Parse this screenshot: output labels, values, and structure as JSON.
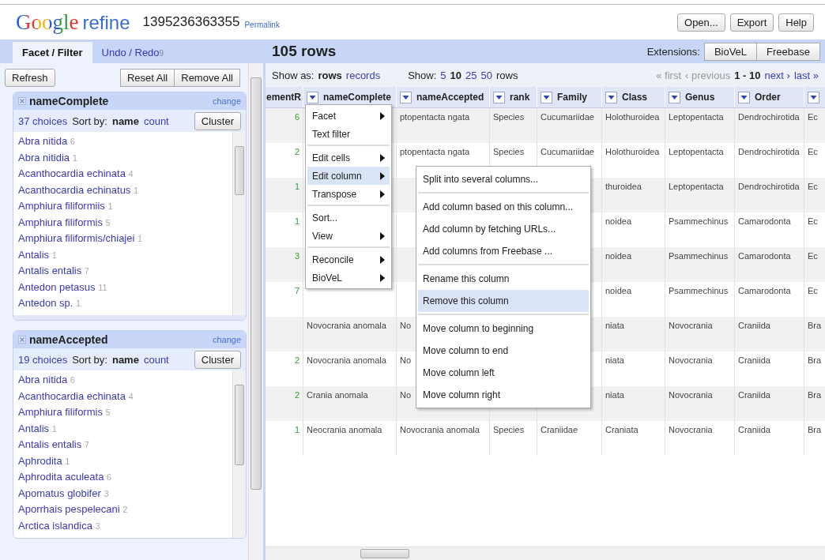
{
  "header": {
    "logo_word": "Google",
    "logo_suffix": "refine",
    "project_name": "1395236363355",
    "permalink": "Permalink",
    "buttons": [
      "Open...",
      "Export",
      "Help"
    ]
  },
  "left_tabs": [
    {
      "label": "Facet / Filter",
      "selected": true
    },
    {
      "label": "Undo / Redo",
      "count": "9",
      "selected": false
    }
  ],
  "facet_buttons": {
    "refresh": "Refresh",
    "others": [
      "Reset All",
      "Remove All"
    ]
  },
  "facets": [
    {
      "title": "nameComplete",
      "change": "change",
      "choices": "37 choices",
      "sort_label": "Sort by:",
      "sort_options": [
        {
          "label": "name",
          "selected": true
        },
        {
          "label": "count",
          "selected": false
        }
      ],
      "cluster": "Cluster",
      "items": [
        {
          "name": "Abra nitida",
          "count": "6"
        },
        {
          "name": "Abra nitidia",
          "count": "1"
        },
        {
          "name": "Acanthocardia echinata",
          "count": "4"
        },
        {
          "name": "Acanthocardia echinatus",
          "count": "1"
        },
        {
          "name": "Amphiura filiformiis",
          "count": "1"
        },
        {
          "name": "Amphiura filiformis",
          "count": "5"
        },
        {
          "name": "Amphiura filiformis/chiajei",
          "count": "1"
        },
        {
          "name": "Antalis",
          "count": "1"
        },
        {
          "name": "Antalis entalis",
          "count": "7"
        },
        {
          "name": "Antedon petasus",
          "count": "11"
        },
        {
          "name": "Antedon sp.",
          "count": "1"
        }
      ]
    },
    {
      "title": "nameAccepted",
      "change": "change",
      "choices": "19 choices",
      "sort_label": "Sort by:",
      "sort_options": [
        {
          "label": "name",
          "selected": true
        },
        {
          "label": "count",
          "selected": false
        }
      ],
      "cluster": "Cluster",
      "items": [
        {
          "name": "Abra nitida",
          "count": "6"
        },
        {
          "name": "Acanthocardia echinata",
          "count": "4"
        },
        {
          "name": "Amphiura filiformis",
          "count": "5"
        },
        {
          "name": "Antalis",
          "count": "1"
        },
        {
          "name": "Antalis entalis",
          "count": "7"
        },
        {
          "name": "Aphrodita",
          "count": "1"
        },
        {
          "name": "Aphrodita aculeata",
          "count": "6"
        },
        {
          "name": "Apomatus globifer",
          "count": "3"
        },
        {
          "name": "Aporrhais pespelecani",
          "count": "2"
        },
        {
          "name": "Arctica islandica",
          "count": "3"
        }
      ]
    }
  ],
  "grid": {
    "row_count": "105 rows",
    "extensions_label": "Extensions:",
    "extensions": [
      "BioVeL",
      "Freebase"
    ],
    "show_as_label": "Show as:",
    "show_as": [
      {
        "label": "rows",
        "selected": true
      },
      {
        "label": "records",
        "selected": false
      }
    ],
    "show_label": "Show:",
    "page_sizes": [
      {
        "label": "5",
        "selected": false
      },
      {
        "label": "10",
        "selected": true
      },
      {
        "label": "25",
        "selected": false
      },
      {
        "label": "50",
        "selected": false
      }
    ],
    "page_sizes_suffix": "rows",
    "pager": [
      {
        "kind": "link",
        "label": "« first",
        "disabled": true
      },
      {
        "kind": "link",
        "label": "‹ previous",
        "disabled": true
      },
      {
        "kind": "range",
        "label": "1 - 10"
      },
      {
        "kind": "link",
        "label": "next ›",
        "disabled": false
      },
      {
        "kind": "link",
        "label": "last »",
        "disabled": false
      }
    ]
  },
  "table": {
    "columns": [
      {
        "label": "ementR",
        "menu_button": false
      },
      {
        "label": "nameComplete",
        "menu_button": true
      },
      {
        "label": "nameAccepted",
        "menu_button": true
      },
      {
        "label": "rank",
        "menu_button": true
      },
      {
        "label": "Family",
        "menu_button": true
      },
      {
        "label": "Class",
        "menu_button": true
      },
      {
        "label": "Genus",
        "menu_button": true
      },
      {
        "label": "Order",
        "menu_button": true
      },
      {
        "menu_button": true
      }
    ],
    "rows": [
      {
        "cells": [
          "6",
          null,
          "ptopentacta ngata",
          "Species",
          "Cucumariidae",
          "Holothuroidea",
          "Leptopentacta",
          "Dendrochirotida",
          "Ec"
        ]
      },
      {
        "cells": [
          "2",
          null,
          "ptopentacta ngata",
          "Species",
          "Cucumariidae",
          "Holothuroidea",
          "Leptopentacta",
          "Dendrochirotida",
          "Ec"
        ]
      },
      {
        "cells": [
          "1",
          null,
          null,
          null,
          null,
          "thuroidea",
          "Leptopentacta",
          "Dendrochirotida",
          "Ec"
        ]
      },
      {
        "cells": [
          "1",
          null,
          null,
          null,
          null,
          "noidea",
          "Psammechinus",
          "Camarodonta",
          "Ec"
        ]
      },
      {
        "cells": [
          "3",
          null,
          null,
          null,
          null,
          "noidea",
          "Psammechinus",
          "Camarodonta",
          "Ec"
        ]
      },
      {
        "cells": [
          "7",
          null,
          null,
          null,
          null,
          "noidea",
          "Psammechinus",
          "Camarodonta",
          "Ec"
        ]
      },
      {
        "cells": [
          null,
          "Novocrania anomala",
          "No",
          null,
          null,
          "niata",
          "Novocrania",
          "Craniida",
          "Bra"
        ]
      },
      {
        "cells": [
          "2",
          "Novocrania anomala",
          "No",
          null,
          null,
          "niata",
          "Novocrania",
          "Craniida",
          "Bra"
        ]
      },
      {
        "cells": [
          "2",
          "Crania anomala",
          "No",
          null,
          null,
          "niata",
          "Novocrania",
          "Craniida",
          "Bra"
        ]
      },
      {
        "cells": [
          "1",
          "Neocrania anomala",
          "Novocrania anomala",
          "Species",
          "Craniidae",
          "Craniata",
          "Novocrania",
          "Craniida",
          "Bra"
        ]
      }
    ]
  },
  "column_menu": {
    "groups": [
      [
        {
          "label": "Facet",
          "submenu": true,
          "selected": false
        },
        {
          "label": "Text filter",
          "submenu": false,
          "selected": false
        }
      ],
      [
        {
          "label": "Edit cells",
          "submenu": true,
          "selected": false
        },
        {
          "label": "Edit column",
          "submenu": true,
          "selected": true
        },
        {
          "label": "Transpose",
          "submenu": true,
          "selected": false
        }
      ],
      [
        {
          "label": "Sort...",
          "submenu": false,
          "selected": false
        },
        {
          "label": "View",
          "submenu": true,
          "selected": false
        }
      ],
      [
        {
          "label": "Reconcile",
          "submenu": true,
          "selected": false
        },
        {
          "label": "BioVeL",
          "submenu": true,
          "selected": false
        }
      ]
    ]
  },
  "submenu": {
    "groups": [
      [
        {
          "label": "Split into several columns...",
          "selected": false
        }
      ],
      [
        {
          "label": "Add column based on this column...",
          "selected": false
        },
        {
          "label": "Add column by fetching URLs...",
          "selected": false
        },
        {
          "label": "Add columns from Freebase ...",
          "selected": false
        }
      ],
      [
        {
          "label": "Rename this column",
          "selected": false
        },
        {
          "label": "Remove this column",
          "selected": true
        }
      ],
      [
        {
          "label": "Move column to beginning",
          "selected": false
        },
        {
          "label": "Move column to end",
          "selected": false
        },
        {
          "label": "Move column left",
          "selected": false
        },
        {
          "label": "Move column right",
          "selected": false
        }
      ]
    ]
  }
}
